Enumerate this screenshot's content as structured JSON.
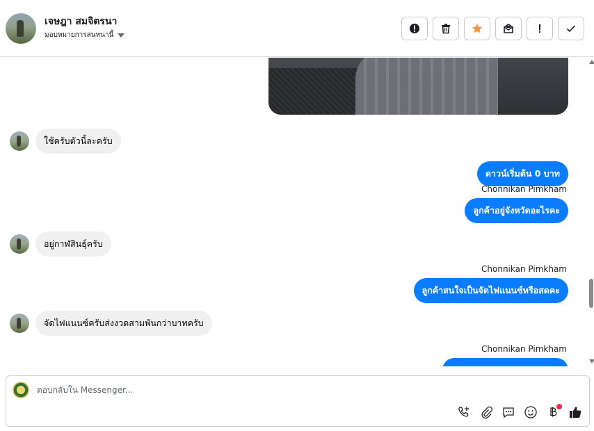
{
  "header": {
    "contact_name": "เจษฎา สมจิตรนา",
    "assign_label": "มอบหมายการสนทนานี้"
  },
  "toolbar": {
    "buttons": [
      "spam-icon",
      "trash-icon",
      "star-icon",
      "unread-icon",
      "follow-up-icon",
      "done-icon"
    ],
    "star_color": "#f7923a"
  },
  "messages": {
    "m1": "ใช้ครับตัวนี้ละครับ",
    "m2": "ดาวน์เริ่มต้น 0 บาท",
    "sender1": "Chonnikan Pimkham",
    "m3": "ลูกค้าอยู่จังหวัดอะไรคะ",
    "m4": "อยู่กาฬสินธุ์ครับ",
    "sender2": "Chonnikan Pimkham",
    "m5": "ลูกค้าสนใจเป็นจัดไฟแนนซ์หรือสดคะ",
    "m6": "จัดไฟแนนซ์ครับส่งงวดสามพันกว่าบาทครับ",
    "sender3": "Chonnikan Pimkham"
  },
  "composer": {
    "placeholder": "ตอบกลับใน Messenger...",
    "icons": [
      "phone-plus-icon",
      "attachment-icon",
      "saved-reply-icon",
      "emoji-icon",
      "baht-icon",
      "like-icon"
    ]
  },
  "colors": {
    "outgoing_bubble": "#0a7cff",
    "incoming_bubble": "#f0f0f0",
    "notification_dot": "#f02849"
  }
}
